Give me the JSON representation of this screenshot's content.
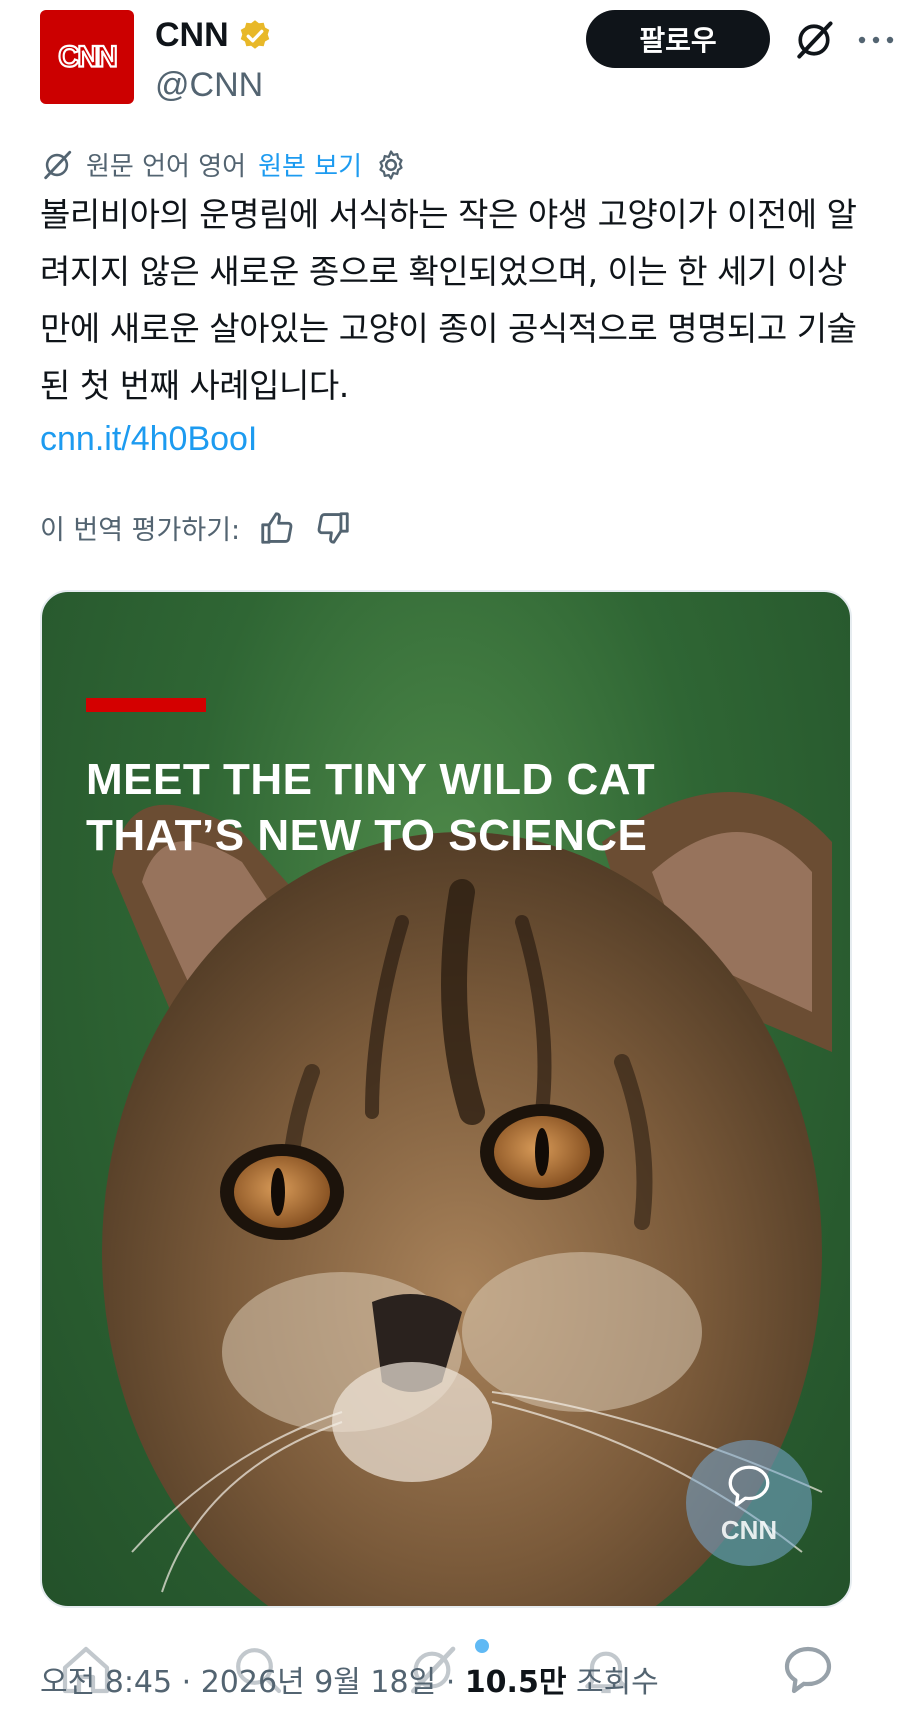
{
  "account": {
    "display_name": "CNN",
    "handle": "@CNN",
    "follow_label": "팔로우",
    "avatar_text": "CNN"
  },
  "translation": {
    "source_language": "원문 언어 영어",
    "show_original": "원본 보기"
  },
  "post": {
    "text": "볼리비아의 운명림에 서식하는 작은 야생 고양이가 이전에 알려지지 않은 새로운 종으로 확인되었으며, 이는 한 세기 이상 만에 새로운 살아있는 고양이 종이 공식적으로 명명되고 기술된 첫 번째 사례입니다.",
    "link": "cnn.it/4h0BooI"
  },
  "rate": {
    "label": "이 번역 평가하기:"
  },
  "media": {
    "headline_line1": "MEET THE TINY WILD CAT",
    "headline_line2": "THAT’S NEW TO SCIENCE",
    "watermark": "CNN"
  },
  "meta": {
    "time": "오전 8:45",
    "date": "2026년 9월 18일",
    "views_count": "10.5만",
    "views_label": "조회수"
  },
  "colors": {
    "brand_red": "#cc0000",
    "link_blue": "#1d9bf0",
    "follow_bg": "#0f1419",
    "muted": "#536471"
  },
  "icons": [
    "verified-badge-icon",
    "grok-icon",
    "more-icon",
    "translate-icon",
    "gear-icon",
    "thumbs-up-icon",
    "thumbs-down-icon",
    "chat-bubble-icon",
    "home-icon",
    "search-icon",
    "grok-nav-icon",
    "notifications-icon",
    "messages-icon"
  ]
}
